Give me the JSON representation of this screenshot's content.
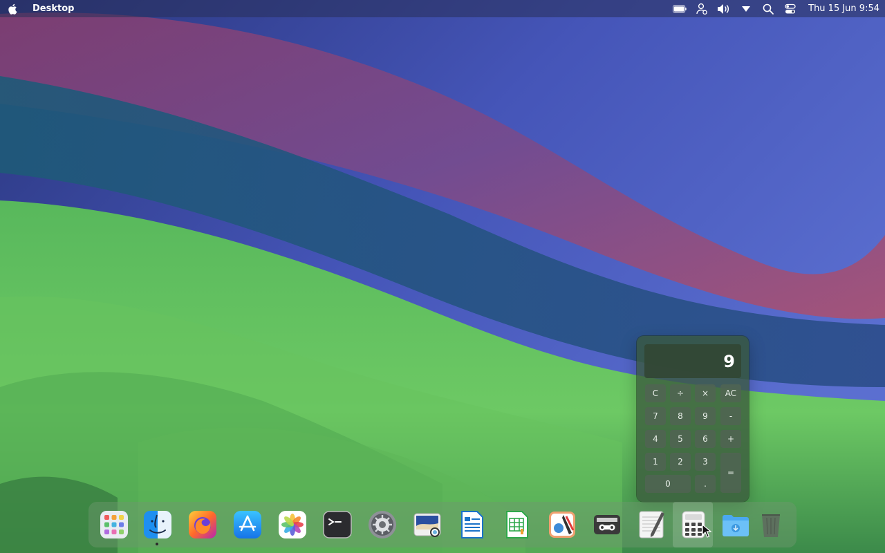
{
  "menubar": {
    "app_title": "Desktop",
    "clock": "Thu 15 Jun  9:54",
    "status_icons": [
      "battery-icon",
      "user-icon",
      "volume-icon",
      "dropdown-icon",
      "search-icon",
      "control-center-icon"
    ]
  },
  "calculator": {
    "display": "9",
    "keys": [
      "C",
      "÷",
      "×",
      "AC",
      "7",
      "8",
      "9",
      "-",
      "4",
      "5",
      "6",
      "+",
      "1",
      "2",
      "3",
      "=",
      "0",
      "."
    ]
  },
  "dock": {
    "items": [
      "launchpad-icon",
      "finder-icon",
      "firefox-icon",
      "app-store-icon",
      "photos-icon",
      "terminal-icon",
      "system-settings-icon",
      "image-viewer-icon",
      "writer-icon",
      "calc-sheet-icon",
      "draw-icon",
      "tape-recorder-icon",
      "text-editor-icon",
      "calculator-icon",
      "downloads-folder-icon",
      "trash-icon"
    ],
    "running": [
      "finder-icon"
    ],
    "active": "calculator-icon"
  },
  "colors": {
    "menubar_bg": "#28305a",
    "calculator_bg": "#3a583c",
    "dock_bg": "#6e966e"
  }
}
